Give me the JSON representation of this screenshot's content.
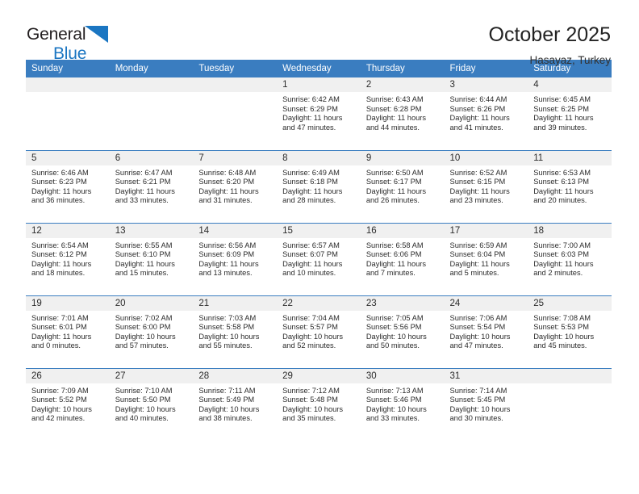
{
  "brand": {
    "name_part1": "General",
    "name_part2": "Blue",
    "triangle_color": "#1b76c2"
  },
  "header": {
    "title": "October 2025",
    "subtitle": "Hasayaz, Turkey"
  },
  "theme": {
    "header_bar_color": "#3a7dc0",
    "daynum_bg": "#f0f0f0",
    "text_color": "#2b2b2b"
  },
  "weekday_headers": [
    "Sunday",
    "Monday",
    "Tuesday",
    "Wednesday",
    "Thursday",
    "Friday",
    "Saturday"
  ],
  "weeks": [
    [
      {
        "day": "",
        "blank": true,
        "sunrise": "",
        "sunset": "",
        "daylight_line1": "",
        "daylight_line2": ""
      },
      {
        "day": "",
        "blank": true,
        "sunrise": "",
        "sunset": "",
        "daylight_line1": "",
        "daylight_line2": ""
      },
      {
        "day": "",
        "blank": true,
        "sunrise": "",
        "sunset": "",
        "daylight_line1": "",
        "daylight_line2": ""
      },
      {
        "day": "1",
        "blank": false,
        "sunrise": "Sunrise: 6:42 AM",
        "sunset": "Sunset: 6:29 PM",
        "daylight_line1": "Daylight: 11 hours",
        "daylight_line2": "and 47 minutes."
      },
      {
        "day": "2",
        "blank": false,
        "sunrise": "Sunrise: 6:43 AM",
        "sunset": "Sunset: 6:28 PM",
        "daylight_line1": "Daylight: 11 hours",
        "daylight_line2": "and 44 minutes."
      },
      {
        "day": "3",
        "blank": false,
        "sunrise": "Sunrise: 6:44 AM",
        "sunset": "Sunset: 6:26 PM",
        "daylight_line1": "Daylight: 11 hours",
        "daylight_line2": "and 41 minutes."
      },
      {
        "day": "4",
        "blank": false,
        "sunrise": "Sunrise: 6:45 AM",
        "sunset": "Sunset: 6:25 PM",
        "daylight_line1": "Daylight: 11 hours",
        "daylight_line2": "and 39 minutes."
      }
    ],
    [
      {
        "day": "5",
        "blank": false,
        "sunrise": "Sunrise: 6:46 AM",
        "sunset": "Sunset: 6:23 PM",
        "daylight_line1": "Daylight: 11 hours",
        "daylight_line2": "and 36 minutes."
      },
      {
        "day": "6",
        "blank": false,
        "sunrise": "Sunrise: 6:47 AM",
        "sunset": "Sunset: 6:21 PM",
        "daylight_line1": "Daylight: 11 hours",
        "daylight_line2": "and 33 minutes."
      },
      {
        "day": "7",
        "blank": false,
        "sunrise": "Sunrise: 6:48 AM",
        "sunset": "Sunset: 6:20 PM",
        "daylight_line1": "Daylight: 11 hours",
        "daylight_line2": "and 31 minutes."
      },
      {
        "day": "8",
        "blank": false,
        "sunrise": "Sunrise: 6:49 AM",
        "sunset": "Sunset: 6:18 PM",
        "daylight_line1": "Daylight: 11 hours",
        "daylight_line2": "and 28 minutes."
      },
      {
        "day": "9",
        "blank": false,
        "sunrise": "Sunrise: 6:50 AM",
        "sunset": "Sunset: 6:17 PM",
        "daylight_line1": "Daylight: 11 hours",
        "daylight_line2": "and 26 minutes."
      },
      {
        "day": "10",
        "blank": false,
        "sunrise": "Sunrise: 6:52 AM",
        "sunset": "Sunset: 6:15 PM",
        "daylight_line1": "Daylight: 11 hours",
        "daylight_line2": "and 23 minutes."
      },
      {
        "day": "11",
        "blank": false,
        "sunrise": "Sunrise: 6:53 AM",
        "sunset": "Sunset: 6:13 PM",
        "daylight_line1": "Daylight: 11 hours",
        "daylight_line2": "and 20 minutes."
      }
    ],
    [
      {
        "day": "12",
        "blank": false,
        "sunrise": "Sunrise: 6:54 AM",
        "sunset": "Sunset: 6:12 PM",
        "daylight_line1": "Daylight: 11 hours",
        "daylight_line2": "and 18 minutes."
      },
      {
        "day": "13",
        "blank": false,
        "sunrise": "Sunrise: 6:55 AM",
        "sunset": "Sunset: 6:10 PM",
        "daylight_line1": "Daylight: 11 hours",
        "daylight_line2": "and 15 minutes."
      },
      {
        "day": "14",
        "blank": false,
        "sunrise": "Sunrise: 6:56 AM",
        "sunset": "Sunset: 6:09 PM",
        "daylight_line1": "Daylight: 11 hours",
        "daylight_line2": "and 13 minutes."
      },
      {
        "day": "15",
        "blank": false,
        "sunrise": "Sunrise: 6:57 AM",
        "sunset": "Sunset: 6:07 PM",
        "daylight_line1": "Daylight: 11 hours",
        "daylight_line2": "and 10 minutes."
      },
      {
        "day": "16",
        "blank": false,
        "sunrise": "Sunrise: 6:58 AM",
        "sunset": "Sunset: 6:06 PM",
        "daylight_line1": "Daylight: 11 hours",
        "daylight_line2": "and 7 minutes."
      },
      {
        "day": "17",
        "blank": false,
        "sunrise": "Sunrise: 6:59 AM",
        "sunset": "Sunset: 6:04 PM",
        "daylight_line1": "Daylight: 11 hours",
        "daylight_line2": "and 5 minutes."
      },
      {
        "day": "18",
        "blank": false,
        "sunrise": "Sunrise: 7:00 AM",
        "sunset": "Sunset: 6:03 PM",
        "daylight_line1": "Daylight: 11 hours",
        "daylight_line2": "and 2 minutes."
      }
    ],
    [
      {
        "day": "19",
        "blank": false,
        "sunrise": "Sunrise: 7:01 AM",
        "sunset": "Sunset: 6:01 PM",
        "daylight_line1": "Daylight: 11 hours",
        "daylight_line2": "and 0 minutes."
      },
      {
        "day": "20",
        "blank": false,
        "sunrise": "Sunrise: 7:02 AM",
        "sunset": "Sunset: 6:00 PM",
        "daylight_line1": "Daylight: 10 hours",
        "daylight_line2": "and 57 minutes."
      },
      {
        "day": "21",
        "blank": false,
        "sunrise": "Sunrise: 7:03 AM",
        "sunset": "Sunset: 5:58 PM",
        "daylight_line1": "Daylight: 10 hours",
        "daylight_line2": "and 55 minutes."
      },
      {
        "day": "22",
        "blank": false,
        "sunrise": "Sunrise: 7:04 AM",
        "sunset": "Sunset: 5:57 PM",
        "daylight_line1": "Daylight: 10 hours",
        "daylight_line2": "and 52 minutes."
      },
      {
        "day": "23",
        "blank": false,
        "sunrise": "Sunrise: 7:05 AM",
        "sunset": "Sunset: 5:56 PM",
        "daylight_line1": "Daylight: 10 hours",
        "daylight_line2": "and 50 minutes."
      },
      {
        "day": "24",
        "blank": false,
        "sunrise": "Sunrise: 7:06 AM",
        "sunset": "Sunset: 5:54 PM",
        "daylight_line1": "Daylight: 10 hours",
        "daylight_line2": "and 47 minutes."
      },
      {
        "day": "25",
        "blank": false,
        "sunrise": "Sunrise: 7:08 AM",
        "sunset": "Sunset: 5:53 PM",
        "daylight_line1": "Daylight: 10 hours",
        "daylight_line2": "and 45 minutes."
      }
    ],
    [
      {
        "day": "26",
        "blank": false,
        "sunrise": "Sunrise: 7:09 AM",
        "sunset": "Sunset: 5:52 PM",
        "daylight_line1": "Daylight: 10 hours",
        "daylight_line2": "and 42 minutes."
      },
      {
        "day": "27",
        "blank": false,
        "sunrise": "Sunrise: 7:10 AM",
        "sunset": "Sunset: 5:50 PM",
        "daylight_line1": "Daylight: 10 hours",
        "daylight_line2": "and 40 minutes."
      },
      {
        "day": "28",
        "blank": false,
        "sunrise": "Sunrise: 7:11 AM",
        "sunset": "Sunset: 5:49 PM",
        "daylight_line1": "Daylight: 10 hours",
        "daylight_line2": "and 38 minutes."
      },
      {
        "day": "29",
        "blank": false,
        "sunrise": "Sunrise: 7:12 AM",
        "sunset": "Sunset: 5:48 PM",
        "daylight_line1": "Daylight: 10 hours",
        "daylight_line2": "and 35 minutes."
      },
      {
        "day": "30",
        "blank": false,
        "sunrise": "Sunrise: 7:13 AM",
        "sunset": "Sunset: 5:46 PM",
        "daylight_line1": "Daylight: 10 hours",
        "daylight_line2": "and 33 minutes."
      },
      {
        "day": "31",
        "blank": false,
        "sunrise": "Sunrise: 7:14 AM",
        "sunset": "Sunset: 5:45 PM",
        "daylight_line1": "Daylight: 10 hours",
        "daylight_line2": "and 30 minutes."
      },
      {
        "day": "",
        "blank": true,
        "sunrise": "",
        "sunset": "",
        "daylight_line1": "",
        "daylight_line2": ""
      }
    ]
  ]
}
